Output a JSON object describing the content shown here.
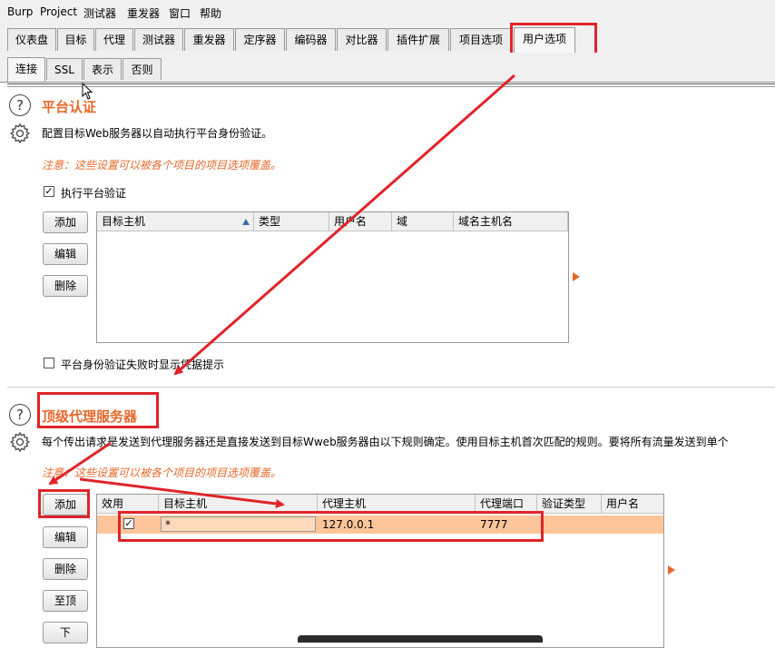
{
  "menubar": {
    "items": [
      "Burp",
      "Project",
      "测试器",
      "重发器",
      "窗口",
      "帮助"
    ]
  },
  "tabs": [
    "仪表盘",
    "目标",
    "代理",
    "测试器",
    "重发器",
    "定序器",
    "编码器",
    "对比器",
    "插件扩展",
    "项目选项",
    "用户选项"
  ],
  "active_tab": "用户选项",
  "subtabs": [
    "连接",
    "SSL",
    "表示",
    "否则"
  ],
  "active_subtab": "连接",
  "platform_auth": {
    "title": "平台认证",
    "description": "配置目标Web服务器以自动执行平台身份验证。",
    "note": "注意：这些设置可以被各个项目的项目选项覆盖。",
    "checkbox_label": "执行平台验证",
    "checkbox_checked": true,
    "buttons": {
      "add": "添加",
      "edit": "编辑",
      "remove": "删除"
    },
    "columns": [
      "目标主机",
      "类型",
      "用户名",
      "域",
      "域名主机名"
    ],
    "prompt_label": "平台身份验证失败时显示凭据提示",
    "prompt_checked": false
  },
  "upstream_proxy": {
    "title": "顶级代理服务器",
    "description": "每个传出请求是发送到代理服务器还是直接发送到目标Wweb服务器由以下规则确定。使用目标主机首次匹配的规则。要将所有流量发送到单个",
    "note": "注意：这些设置可以被各个项目的项目选项覆盖。",
    "buttons": {
      "add": "添加",
      "edit": "编辑",
      "remove": "删除",
      "up": "至顶",
      "down": "下"
    },
    "columns": [
      "效用",
      "目标主机",
      "代理主机",
      "代理端口",
      "验证类型",
      "用户名"
    ],
    "rows": [
      {
        "enabled": true,
        "enabled_mark": "✓",
        "dest_host": "*",
        "proxy_host": "127.0.0.1",
        "proxy_port": "7777",
        "auth_type": "",
        "username": ""
      }
    ]
  },
  "icons": [
    "help-icon",
    "gear-icon",
    "sort-asc-icon",
    "expand-arrow-icon",
    "mouse-cursor-icon"
  ],
  "colors": {
    "accent": "#e5682b",
    "selected_row": "#ffc59a",
    "annotation": "#e0242a"
  }
}
